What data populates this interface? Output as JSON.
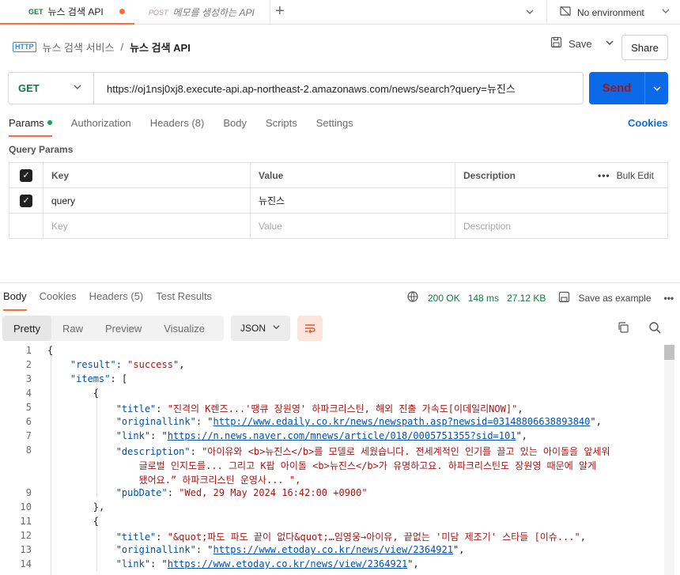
{
  "tabs": [
    {
      "method": "GET",
      "label": "뉴스 검색 API"
    },
    {
      "method": "POST",
      "label": "메모를 생성하는 API"
    }
  ],
  "environment": "No environment",
  "breadcrumb": {
    "parent": "뉴스 검색 서비스",
    "separator": "/",
    "current": "뉴스 검색 API"
  },
  "actions": {
    "save": "Save",
    "share": "Share"
  },
  "request": {
    "method": "GET",
    "url": "https://oj1nsj0xj8.execute-api.ap-northeast-2.amazonaws.com/news/search?query=뉴진스",
    "send": "Send",
    "tabs": [
      "Params",
      "Authorization",
      "Headers (8)",
      "Body",
      "Scripts",
      "Settings"
    ],
    "cookies": "Cookies"
  },
  "params": {
    "title": "Query Params",
    "headers": {
      "key": "Key",
      "value": "Value",
      "description": "Description",
      "bulk_edit": "Bulk Edit"
    },
    "rows": [
      {
        "key": "query",
        "value": "뉴진스",
        "description": ""
      }
    ],
    "placeholder": {
      "key": "Key",
      "value": "Value",
      "description": "Description"
    }
  },
  "response": {
    "tabs": [
      "Body",
      "Cookies",
      "Headers (5)",
      "Test Results"
    ],
    "status": "200 OK",
    "time": "148 ms",
    "size": "27.12 KB",
    "save_example": "Save as example",
    "formats": [
      "Pretty",
      "Raw",
      "Preview",
      "Visualize"
    ],
    "language": "JSON"
  },
  "code_lines": [
    {
      "n": "1",
      "t": "{"
    },
    {
      "n": "2",
      "t": "    \"result\": \"success\","
    },
    {
      "n": "3",
      "t": "    \"items\": ["
    },
    {
      "n": "4",
      "t": "        {"
    },
    {
      "n": "5",
      "t": "            \"title\": \"진격의 K렌즈...'땡큐 장원영' 하파크리스틴, 해외 진출 가속도[이데일리NOW]\","
    },
    {
      "n": "6",
      "t": "            \"originallink\": \"http://www.edaily.co.kr/news/newspath.asp?newsid=03148806638893840\","
    },
    {
      "n": "7",
      "t": "            \"link\": \"https://n.news.naver.com/mnews/article/018/0005751355?sid=101\","
    },
    {
      "n": "8",
      "t": "            \"description\": \"아이유와 <b>뉴진스</b>를 모델로 세웠습니다. 전세계적인 인기를 끌고 있는 아이돌을 앞세워"
    },
    {
      "n": "",
      "t": "                글로벌 인지도를... 그리고 K팝 아이돌 <b>뉴진스</b>가 유명하고요. 하파크리스틴도 장원영 때문에 알게"
    },
    {
      "n": "",
      "t": "                됐어요.” 하파크리스틴 운영사... \","
    },
    {
      "n": "9",
      "t": "            \"pubDate\": \"Wed, 29 May 2024 16:42:00 +0900\""
    },
    {
      "n": "10",
      "t": "        },"
    },
    {
      "n": "11",
      "t": "        {"
    },
    {
      "n": "12",
      "t": "            \"title\": \"&quot;파도 파도 끝이 없다&quot;…임영웅→아이유, 끝없는 '미담 제조기' 스타들 [이슈...\","
    },
    {
      "n": "13",
      "t": "            \"originallink\": \"https://www.etoday.co.kr/news/view/2364921\","
    },
    {
      "n": "14",
      "t": "            \"link\": \"https://www.etoday.co.kr/news/view/2364921\","
    }
  ]
}
